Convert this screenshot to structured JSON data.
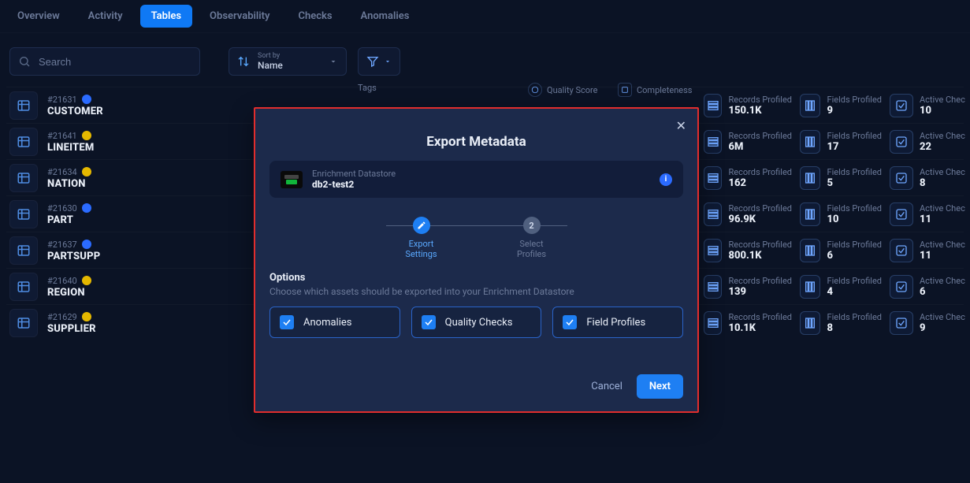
{
  "tabs": [
    "Overview",
    "Activity",
    "Tables",
    "Observability",
    "Checks",
    "Anomalies"
  ],
  "active_tab_index": 2,
  "search": {
    "placeholder": "Search"
  },
  "sort": {
    "top": "Sort by",
    "value": "Name"
  },
  "headers": {
    "tags": "Tags",
    "quality": "Quality Score",
    "completeness": "Completeness",
    "records": "Records Profiled",
    "fields": "Fields Profiled",
    "active": "Active Chec"
  },
  "rows": [
    {
      "id": "#21631",
      "name": "CUSTOMER",
      "dot": "blue",
      "records": "150.1K",
      "fields": "9",
      "active": "10"
    },
    {
      "id": "#21641",
      "name": "LINEITEM",
      "dot": "yellow",
      "records": "6M",
      "fields": "17",
      "active": "22"
    },
    {
      "id": "#21634",
      "name": "NATION",
      "dot": "yellow",
      "records": "162",
      "fields": "5",
      "active": "8"
    },
    {
      "id": "#21630",
      "name": "PART",
      "dot": "blue",
      "records": "96.9K",
      "fields": "10",
      "active": "11"
    },
    {
      "id": "#21637",
      "name": "PARTSUPP",
      "dot": "blue",
      "records": "800.1K",
      "fields": "6",
      "active": "11"
    },
    {
      "id": "#21640",
      "name": "REGION",
      "dot": "yellow",
      "records": "139",
      "fields": "4",
      "active": "6"
    },
    {
      "id": "#21629",
      "name": "SUPPLIER",
      "dot": "yellow",
      "records": "10.1K",
      "fields": "8",
      "active": "9"
    }
  ],
  "modal": {
    "title": "Export Metadata",
    "datastore": {
      "label": "Enrichment Datastore",
      "name": "db2-test2"
    },
    "steps": [
      {
        "label": "Export\nSettings",
        "state": "active"
      },
      {
        "num": "2",
        "label": "Select\nProfiles",
        "state": "idle"
      }
    ],
    "options_title": "Options",
    "options_sub": "Choose which assets should be exported into your Enrichment Datastore",
    "options": [
      "Anomalies",
      "Quality Checks",
      "Field Profiles"
    ],
    "cancel": "Cancel",
    "next": "Next"
  }
}
